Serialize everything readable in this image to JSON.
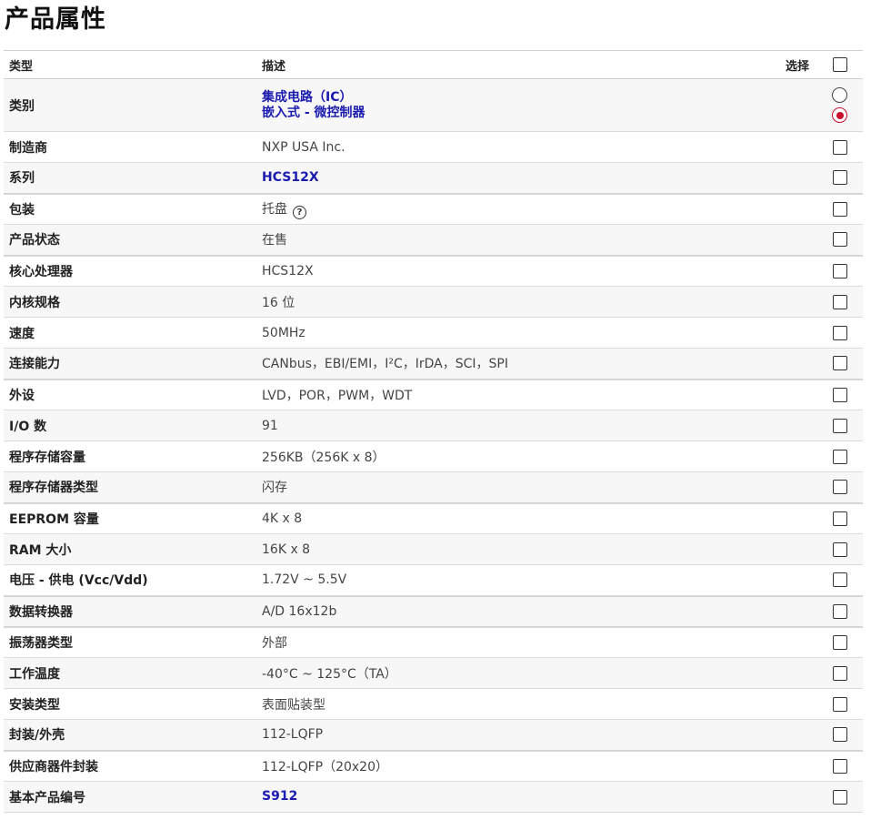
{
  "title": "产品属性",
  "table": {
    "headers": {
      "type": "类型",
      "description": "描述",
      "select": "选择"
    },
    "rows": [
      {
        "key": "category",
        "label": "类别",
        "values": [
          "集成电路（IC）",
          "嵌入式 - 微控制器"
        ],
        "link": true,
        "control": "radio",
        "radios": [
          false,
          true
        ]
      },
      {
        "key": "manufacturer",
        "label": "制造商",
        "value": "NXP USA Inc.",
        "link": false,
        "control": "checkbox"
      },
      {
        "key": "series",
        "label": "系列",
        "value": "HCS12X",
        "link": true,
        "control": "checkbox"
      },
      {
        "key": "package",
        "label": "包装",
        "value": "托盘",
        "link": false,
        "help_icon": "question-circle-icon",
        "control": "checkbox"
      },
      {
        "key": "product-status",
        "label": "产品状态",
        "value": "在售",
        "link": false,
        "control": "checkbox"
      },
      {
        "key": "core-processor",
        "label": "核心处理器",
        "value": "HCS12X",
        "link": false,
        "control": "checkbox"
      },
      {
        "key": "core-size",
        "label": "内核规格",
        "value": "16 位",
        "link": false,
        "control": "checkbox"
      },
      {
        "key": "speed",
        "label": "速度",
        "value": "50MHz",
        "link": false,
        "control": "checkbox"
      },
      {
        "key": "connectivity",
        "label": "连接能力",
        "value": "CANbus，EBI/EMI，I²C，IrDA，SCI，SPI",
        "link": false,
        "control": "checkbox"
      },
      {
        "key": "peripherals",
        "label": "外设",
        "value": "LVD，POR，PWM，WDT",
        "link": false,
        "control": "checkbox"
      },
      {
        "key": "io-count",
        "label": "I/O 数",
        "value": "91",
        "link": false,
        "control": "checkbox"
      },
      {
        "key": "program-memory-size",
        "label": "程序存储容量",
        "value": "256KB（256K x 8）",
        "link": false,
        "control": "checkbox"
      },
      {
        "key": "program-memory-type",
        "label": "程序存储器类型",
        "value": "闪存",
        "link": false,
        "control": "checkbox"
      },
      {
        "key": "eeprom-size",
        "label": "EEPROM 容量",
        "value": "4K x 8",
        "link": false,
        "control": "checkbox"
      },
      {
        "key": "ram-size",
        "label": "RAM 大小",
        "value": "16K x 8",
        "link": false,
        "control": "checkbox"
      },
      {
        "key": "voltage-supply",
        "label": "电压 - 供电 (Vcc/Vdd)",
        "value": "1.72V ~ 5.5V",
        "link": false,
        "control": "checkbox"
      },
      {
        "key": "data-converters",
        "label": "数据转换器",
        "value": "A/D 16x12b",
        "link": false,
        "control": "checkbox"
      },
      {
        "key": "oscillator-type",
        "label": "振荡器类型",
        "value": "外部",
        "link": false,
        "control": "checkbox"
      },
      {
        "key": "operating-temperature",
        "label": "工作温度",
        "value": "-40°C ~ 125°C（TA）",
        "link": false,
        "control": "checkbox"
      },
      {
        "key": "mounting-type",
        "label": "安装类型",
        "value": "表面贴装型",
        "link": false,
        "control": "checkbox"
      },
      {
        "key": "package-case",
        "label": "封装/外壳",
        "value": "112-LQFP",
        "link": false,
        "control": "checkbox"
      },
      {
        "key": "supplier-device-package",
        "label": "供应商器件封装",
        "value": "112-LQFP（20x20）",
        "link": false,
        "control": "checkbox"
      },
      {
        "key": "base-product-number",
        "label": "基本产品编号",
        "value": "S912",
        "link": true,
        "control": "checkbox"
      }
    ]
  },
  "colors": {
    "link": "#1b1bb0",
    "radio_selected": "#c8102e"
  }
}
